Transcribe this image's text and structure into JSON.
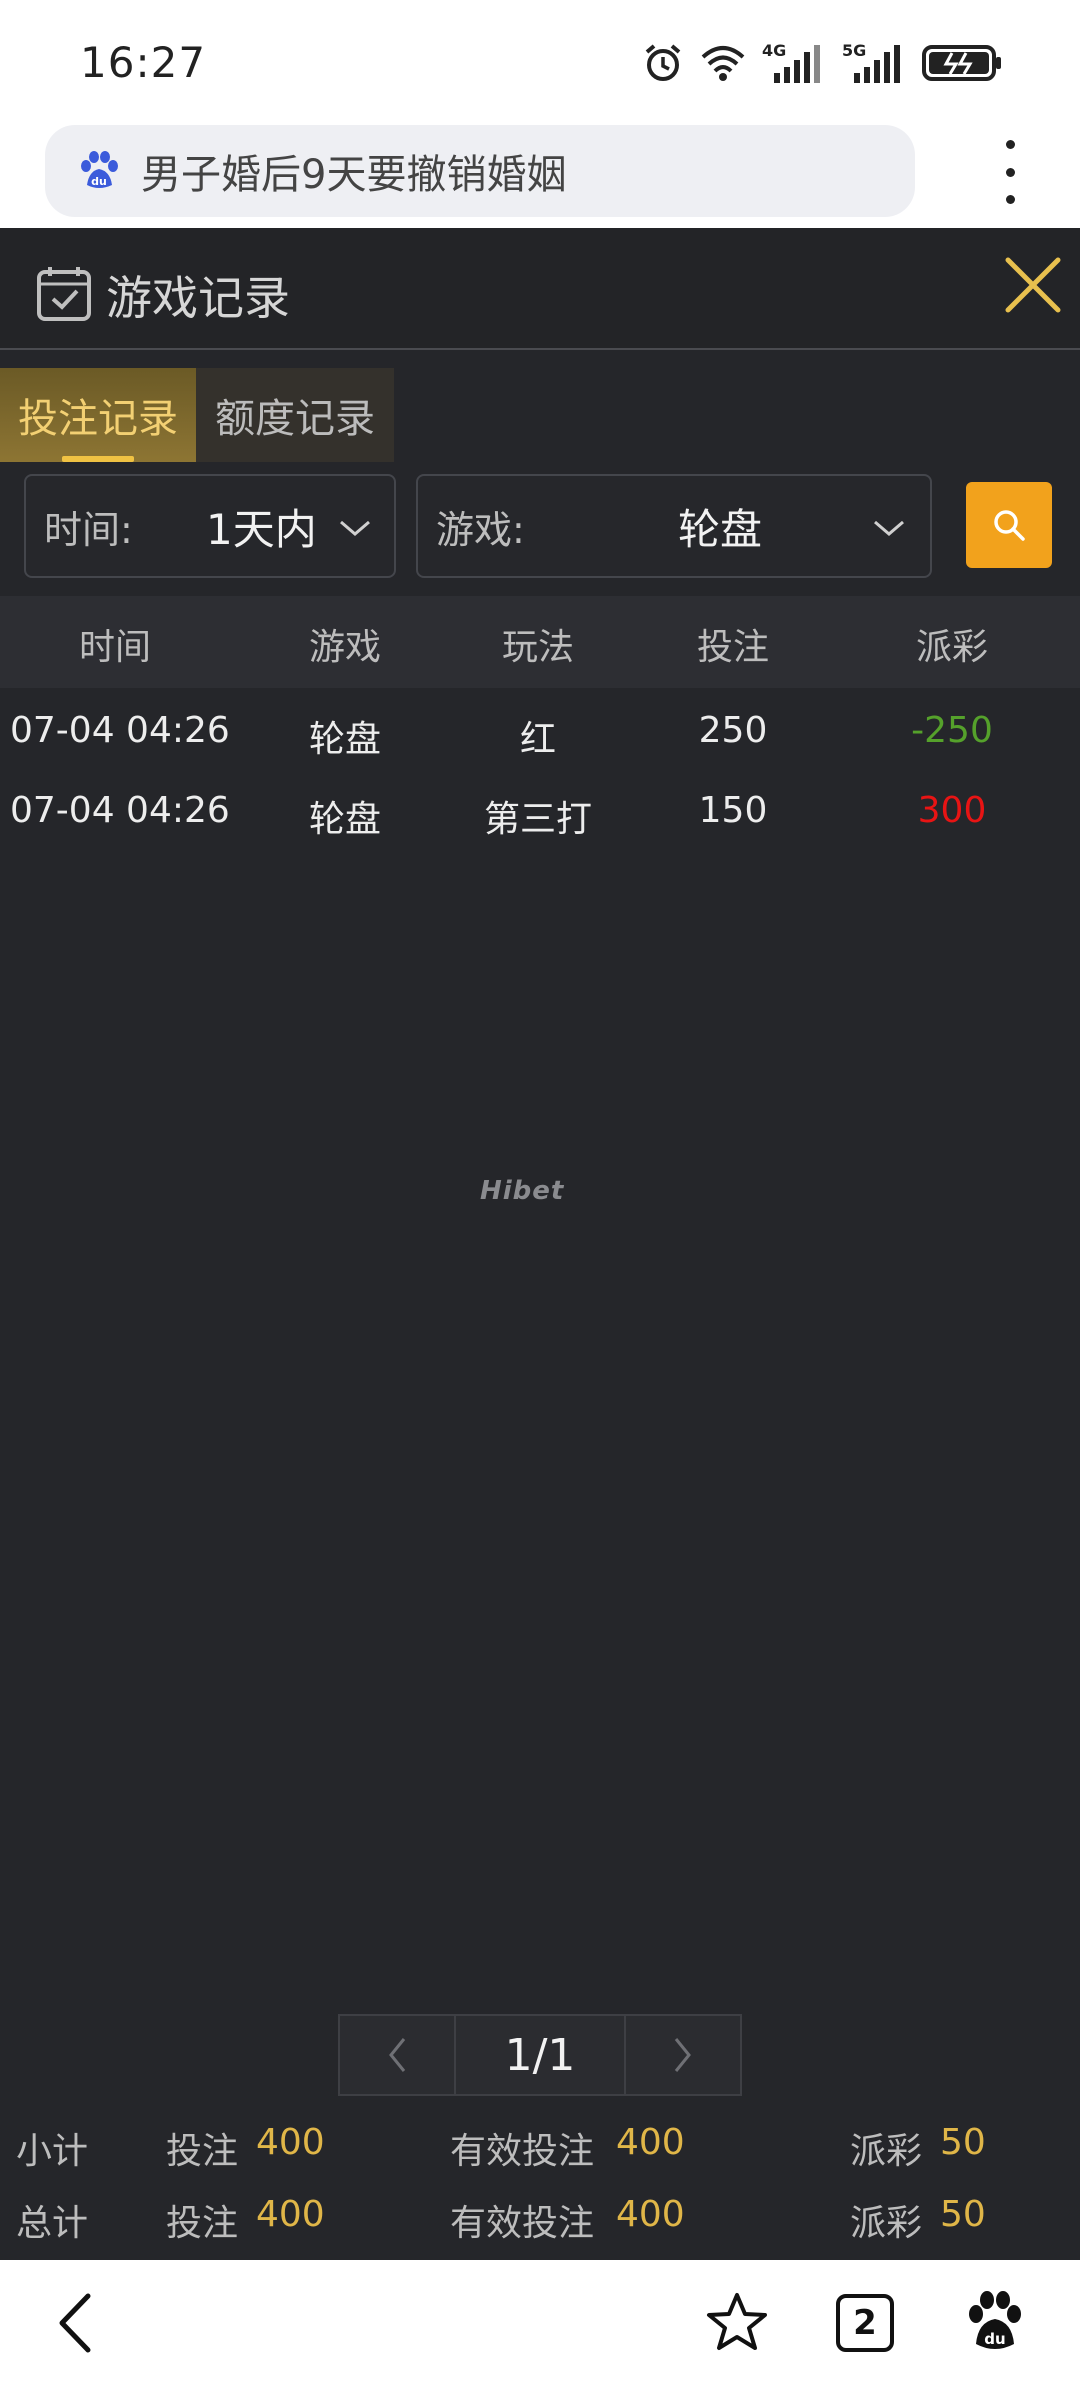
{
  "status_bar": {
    "time": "16:27",
    "icons": [
      "alarm-icon",
      "wifi-icon",
      "signal-4g-icon",
      "signal-5g-icon",
      "battery-charging-icon"
    ],
    "network_labels": [
      "4G",
      "5G"
    ]
  },
  "browser": {
    "search_text": "男子婚后9天要撤销婚姻",
    "logo_icon": "baidu-paw-icon",
    "menu_icon": "more-vertical-icon"
  },
  "app": {
    "title": "游戏记录",
    "tabs": [
      {
        "label": "投注记录",
        "active": true
      },
      {
        "label": "额度记录",
        "active": false
      }
    ],
    "filters": {
      "time_label": "时间:",
      "time_value": "1天内",
      "game_label": "游戏:",
      "game_value": "轮盘"
    },
    "table": {
      "headers": [
        "时间",
        "游戏",
        "玩法",
        "投注",
        "派彩"
      ],
      "rows": [
        {
          "time": "07-04 04:26",
          "game": "轮盘",
          "play": "红",
          "bet": "250",
          "payout": "-250"
        },
        {
          "time": "07-04 04:26",
          "game": "轮盘",
          "play": "第三打",
          "bet": "150",
          "payout": "300"
        }
      ]
    },
    "watermark": "Hibet",
    "pager": {
      "current": "1/1"
    },
    "summary": {
      "subtotal": {
        "label": "小计",
        "bet_label": "投注",
        "bet": "400",
        "valid_label": "有效投注",
        "valid": "400",
        "payout_label": "派彩",
        "payout": "50"
      },
      "total": {
        "label": "总计",
        "bet_label": "投注",
        "bet": "400",
        "valid_label": "有效投注",
        "valid": "400",
        "payout_label": "派彩",
        "payout": "50"
      }
    }
  },
  "bottom_nav": {
    "tab_count": "2"
  },
  "colors": {
    "accent_gold": "#f0c243",
    "search_button": "#f2a21c",
    "payout_negative": "#55a12b",
    "payout_positive": "#e81414",
    "panel_bg": "#25262a"
  }
}
